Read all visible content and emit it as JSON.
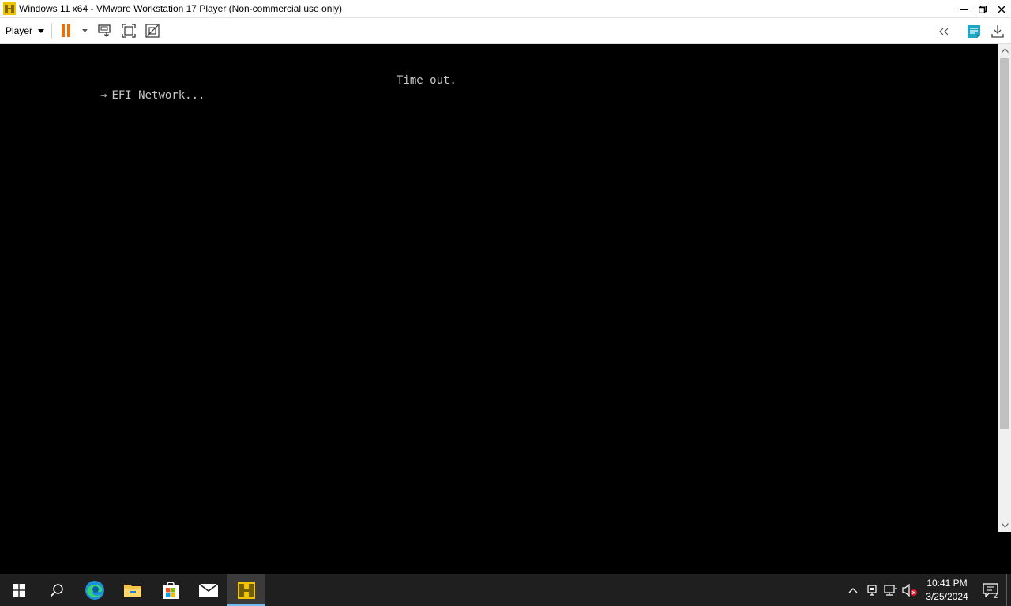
{
  "window": {
    "title": "Windows 11 x64 - VMware Workstation 17 Player (Non-commercial use only)",
    "app_icon": "vmware-player-icon",
    "controls": [
      "minimize-icon",
      "restore-icon",
      "close-icon"
    ]
  },
  "toolbar": {
    "player_menu_label": "Player",
    "buttons": [
      "pause-icon",
      "pause-dropdown-icon",
      "send-ctrl-alt-del-icon",
      "full-screen-icon",
      "unity-icon"
    ],
    "right_buttons": [
      "collapse-toolbar-icon",
      "message-log-icon",
      "download-icon"
    ],
    "accent_color": "#e8700a"
  },
  "vm_console": {
    "timeout_text": "Time out.",
    "boot_option_arrow": "→",
    "boot_option_label": "EFI Network..."
  },
  "taskbar": {
    "items": [
      "start-icon",
      "search-icon",
      "edge-icon",
      "file-explorer-icon",
      "store-icon",
      "mail-icon",
      "vmware-player-icon"
    ],
    "active_item": "vmware-player-icon",
    "tray_icons": [
      "show-hidden-icons-icon",
      "vmware-tray-icon",
      "network-icon",
      "volume-muted-icon"
    ],
    "time": "10:41 PM",
    "date": "3/25/2024",
    "notification_count": "2"
  }
}
